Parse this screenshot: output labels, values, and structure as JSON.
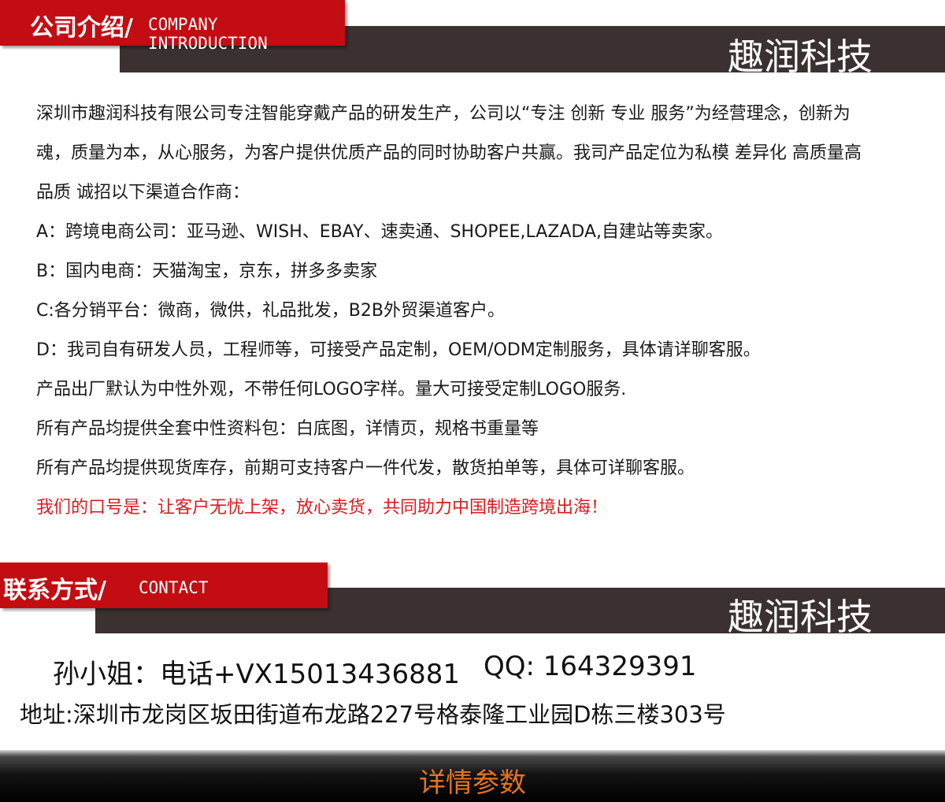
{
  "intro_section": {
    "title_cn": "公司介绍/",
    "title_en": "COMPANY INTRODUCTION",
    "brand": "趣润科技"
  },
  "intro_paragraph": [
    "深圳市趣润科技有限公司专注智能穿戴产品的研发生产，公司以“专注 创新 专业 服务”为经营理念，创新为",
    "魂，质量为本，从心服务，为客户提供优质产品的同时协助客户共赢。我司产品定位为私模 差异化 高质量高",
    "品质 诚招以下渠道合作商："
  ],
  "channels": [
    "A：跨境电商公司：亚马逊、WISH、EBAY、速卖通、SHOPEE,LAZADA,自建站等卖家。",
    "B：国内电商：天猫淘宝，京东，拼多多卖家",
    "C:各分销平台：微商，微供，礼品批发，B2B外贸渠道客户。",
    "D：我司自有研发人员，工程师等，可接受产品定制，OEM/ODM定制服务，具体请详聊客服。"
  ],
  "notes": [
    "产品出厂默认为中性外观，不带任何LOGO字样。量大可接受定制LOGO服务.",
    "所有产品均提供全套中性资料包：白底图，详情页，规格书重量等",
    "所有产品均提供现货库存，前期可支持客户一件代发，散货拍单等，具体可详聊客服。"
  ],
  "slogan": "我们的口号是：让客户无忧上架，放心卖货，共同助力中国制造跨境出海！",
  "contact_section": {
    "title_cn": "联系方式/",
    "title_en": "CONTACT",
    "brand": "趣润科技"
  },
  "contact": {
    "person_phone": "孙小姐：电话+VX15013436881",
    "qq": "QQ: 164329391",
    "address": "地址:深圳市龙岗区坂田街道布龙路227号格泰隆工业园D栋三楼303号"
  },
  "footer": {
    "title": "详情参数"
  },
  "colors": {
    "accent_red": "#c30d12",
    "dark_band": "#3a3130",
    "slogan_red": "#e0181e",
    "footer_text": "#e8731c"
  }
}
